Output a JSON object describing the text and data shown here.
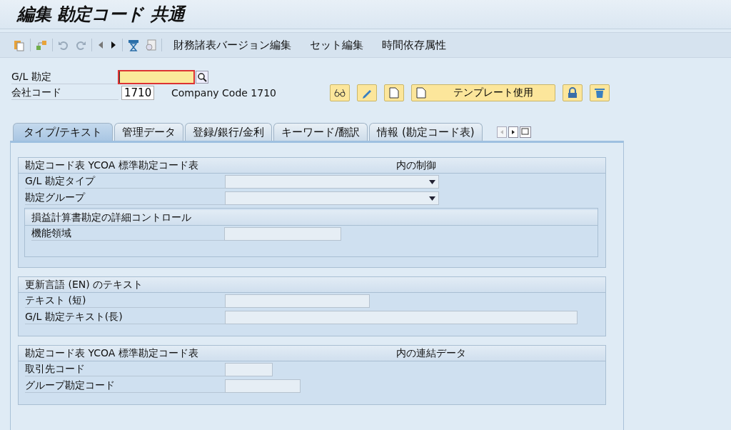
{
  "window": {
    "title": "編集 勘定コード 共通"
  },
  "toolbar": {
    "menu_items": [
      "財務諸表バージョン編集",
      "セット編集",
      "時間依存属性"
    ]
  },
  "header_fields": [
    {
      "label": "G/L 勘定",
      "required": true,
      "focused": true
    },
    {
      "label": "会社コード",
      "value": "1710",
      "description": "Company Code 1710",
      "required": false,
      "focused": false
    }
  ],
  "action_buttons": [
    {
      "kind": "icon"
    },
    {
      "kind": "icon"
    },
    {
      "kind": "icon"
    },
    {
      "kind": "text",
      "label": "テンプレート使用"
    },
    {
      "kind": "icon"
    },
    {
      "kind": "icon"
    }
  ],
  "tabs": [
    {
      "label": "タイプ/テキスト",
      "selected": true
    },
    {
      "label": "管理データ",
      "selected": false
    },
    {
      "label": "登録/銀行/金利",
      "selected": false
    },
    {
      "label": "キーワード/翻訳",
      "selected": false
    },
    {
      "label": "情報 (勘定コード表)",
      "selected": false
    }
  ],
  "sections": [
    {
      "title": "勘定コード表 YCOA 標準勘定コード表",
      "title_right": "内の制御",
      "fields": [
        {
          "label": "G/L 勘定タイプ",
          "kind": "dropdown"
        },
        {
          "label": "勘定グループ",
          "kind": "dropdown"
        }
      ],
      "subsection": {
        "title": "損益計算書勘定の詳細コントロール",
        "fields": [
          {
            "label": "機能領域",
            "kind": "input"
          }
        ]
      }
    },
    {
      "title": "更新言語 (EN) のテキスト",
      "fields": [
        {
          "label": "テキスト (短)",
          "kind": "input"
        },
        {
          "label": "G/L 勘定テキスト(長)",
          "kind": "input"
        }
      ]
    },
    {
      "title": "勘定コード表 YCOA 標準勘定コード表",
      "title_right": "内の連結データ",
      "fields": [
        {
          "label": "取引先コード",
          "kind": "input"
        },
        {
          "label": "グループ勘定コード",
          "kind": "input"
        }
      ]
    }
  ]
}
